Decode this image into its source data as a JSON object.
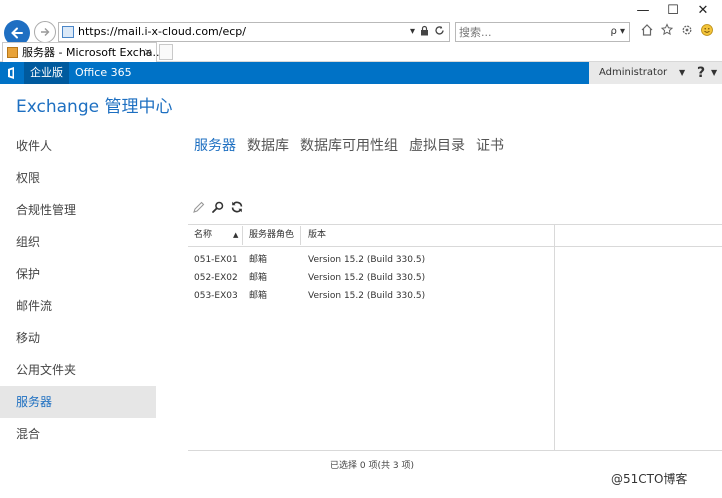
{
  "browser": {
    "url": "https://mail.i-x-cloud.com/ecp/",
    "search_placeholder": "搜索...",
    "tab_title": "服务器 - Microsoft Excha...",
    "tab_close": "×",
    "window_min": "—",
    "window_max": "☐",
    "window_close": "✕",
    "addr_dropdown": "▾",
    "search_glyph": "ρ ▾"
  },
  "suite_bar": {
    "active_label": "企业版",
    "link_label": "Office 365",
    "admin_name": "Administrator",
    "help_label": "?"
  },
  "app": {
    "title": "Exchange 管理中心"
  },
  "sidebar": {
    "items": [
      {
        "label": "收件人"
      },
      {
        "label": "权限"
      },
      {
        "label": "合规性管理"
      },
      {
        "label": "组织"
      },
      {
        "label": "保护"
      },
      {
        "label": "邮件流"
      },
      {
        "label": "移动"
      },
      {
        "label": "公用文件夹"
      },
      {
        "label": "服务器",
        "active": true
      },
      {
        "label": "混合"
      }
    ]
  },
  "main": {
    "tabs": [
      {
        "label": "服务器",
        "active": true
      },
      {
        "label": "数据库"
      },
      {
        "label": "数据库可用性组"
      },
      {
        "label": "虚拟目录"
      },
      {
        "label": "证书"
      }
    ],
    "toolbar": [
      "edit-icon",
      "search-icon",
      "refresh-icon"
    ],
    "table": {
      "columns": [
        "名称",
        "服务器角色",
        "版本"
      ],
      "rows": [
        [
          "051-EX01",
          "邮箱",
          "Version 15.2 (Build 330.5)"
        ],
        [
          "052-EX02",
          "邮箱",
          "Version 15.2 (Build 330.5)"
        ],
        [
          "053-EX03",
          "邮箱",
          "Version 15.2 (Build 330.5)"
        ]
      ]
    },
    "status_text": "已选择 0 项(共 3 项)"
  },
  "watermark": "@51CTO博客",
  "colors": {
    "accent": "#1d6fc1",
    "suite_bar": "#0072c6"
  }
}
